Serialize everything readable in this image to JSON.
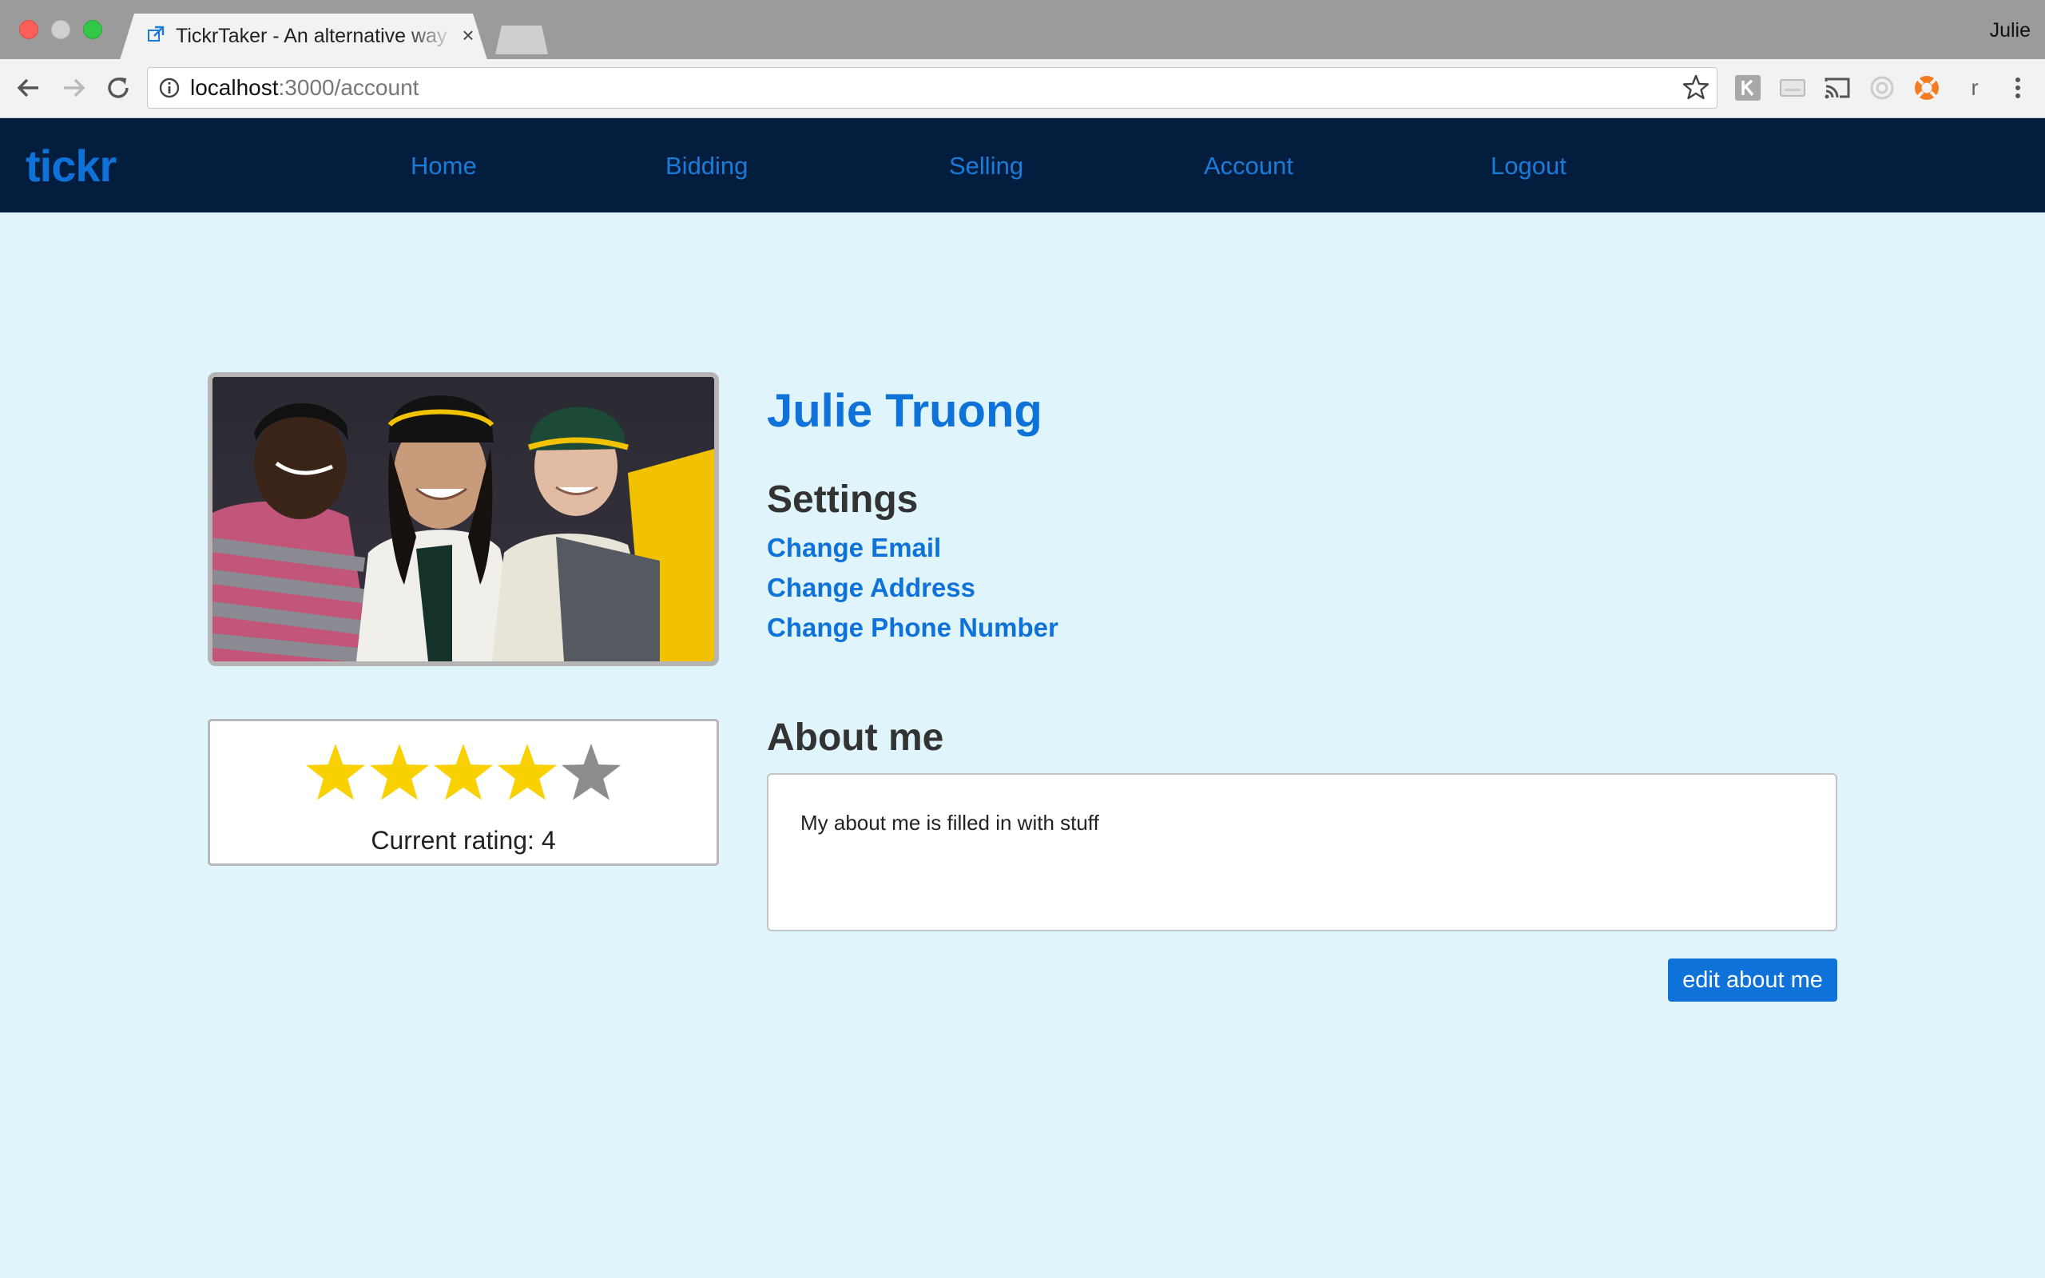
{
  "browser": {
    "tab_title": "TickrTaker - An alternative way",
    "tab_close": "×",
    "profile_name": "Julie",
    "url_host": "localhost",
    "url_rest": ":3000/account",
    "extension_r_label": "r"
  },
  "nav": {
    "logo": "tickr",
    "links": [
      "Home",
      "Bidding",
      "Selling",
      "Account",
      "Logout"
    ]
  },
  "profile": {
    "name": "Julie Truong",
    "settings_heading": "Settings",
    "settings_links": [
      "Change Email",
      "Change Address",
      "Change Phone Number"
    ],
    "rating": {
      "value": 4,
      "max": 5,
      "text": "Current rating: 4",
      "filled_color": "#f9d000",
      "empty_color": "#8c8c8c"
    },
    "about_heading": "About me",
    "about_text": "My about me is filled in with stuff",
    "edit_button": "edit about me"
  },
  "colors": {
    "page_bg": "#e0f4fb",
    "nav_bg": "#031d3f",
    "accent": "#0f72d8"
  }
}
